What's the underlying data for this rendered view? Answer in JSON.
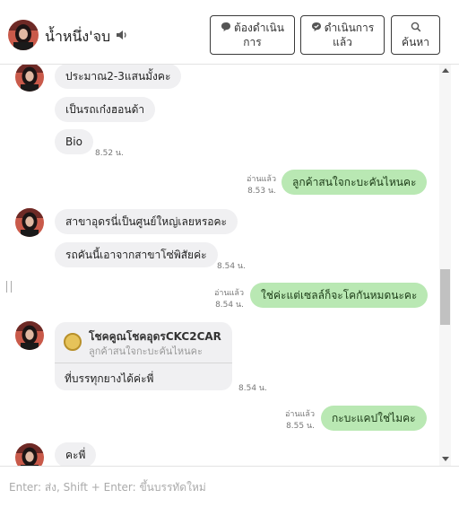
{
  "header": {
    "contact_name": "น้ำหนึ่ง'จบ",
    "buttons": {
      "pending": {
        "line1": "ต้องดำเนิน",
        "line2": "การ"
      },
      "done": {
        "line1": "ดำเนินการ",
        "line2": "แล้ว"
      },
      "search": {
        "label": "ค้นหา"
      }
    }
  },
  "messages": [
    {
      "dir": "in",
      "text": "ประมาณ2-3แสนมั้งคะ",
      "avatar": true
    },
    {
      "dir": "in",
      "text": "เป็นรถเก๋งฮอนด้า"
    },
    {
      "dir": "in",
      "text": "Bio",
      "time": "8.52 น."
    },
    {
      "dir": "out",
      "text": "ลูกค้าสนใจกะบะคันไหนคะ",
      "read": "อ่านแล้ว",
      "time": "8.53 น."
    },
    {
      "dir": "in",
      "text": "สาขาอุดรนี่เป็นศูนย์ใหญ่เลยหรอคะ",
      "avatar": true
    },
    {
      "dir": "in",
      "text": "รถคันนี้เอาจากสาขาโซ่พิสัยค่ะ",
      "time": "8.54 น."
    },
    {
      "dir": "out",
      "text": "ใช่ค่ะแต่เซลล์ก็จะโคกันหมดนะคะ",
      "read": "อ่านแล้ว",
      "time": "8.54 น."
    },
    {
      "dir": "in",
      "type": "reply-card",
      "card_title": "โชคคูณโชคอุดรCKC2CAR",
      "card_quote": "ลูกค้าสนใจกะบะคันไหนคะ",
      "text": "ที่บรรทุกยางได้ค่ะพี่",
      "time": "8.54 น.",
      "avatar": true
    },
    {
      "dir": "out",
      "text": "กะบะแคปใช่ไมคะ",
      "read": "อ่านแล้ว",
      "time": "8.55 น."
    },
    {
      "dir": "in",
      "text": "คะพี่",
      "avatar": true
    }
  ],
  "composer": {
    "placeholder": "Enter: ส่ง, Shift + Enter: ขึ้นบรรทัดใหม่"
  },
  "colors": {
    "incoming_bubble": "#f0f0f2",
    "outgoing_bubble": "#b9e8b3",
    "border": "#3a3a3a"
  },
  "icons": [
    "speaker-icon",
    "chat-bubble-icon",
    "chat-check-icon",
    "search-icon",
    "scroll-up-icon",
    "scroll-down-icon"
  ]
}
